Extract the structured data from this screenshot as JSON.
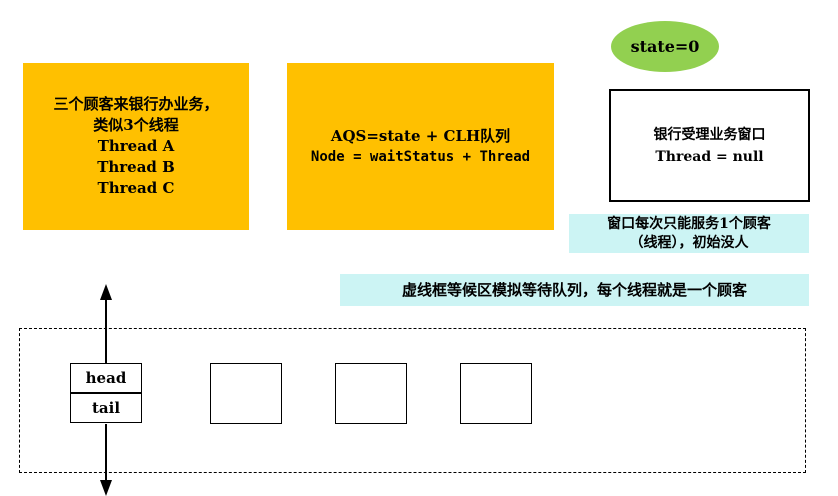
{
  "customers_box": {
    "lines": [
      "三个顾客来银行办业务，",
      "类似3个线程",
      "Thread A",
      "Thread B",
      "Thread C"
    ]
  },
  "aqs_box": {
    "line1": "AQS=state + CLH队列",
    "line2": "Node = waitStatus + Thread"
  },
  "state_oval": "state=0",
  "window_box": {
    "line1": "银行受理业务窗口",
    "line2": "Thread = null"
  },
  "window_note": {
    "line1": "窗口每次只能服务1个顾客",
    "line2": "（线程），初始没人"
  },
  "queue_note": "虚线框等候区模拟等待队列，每个线程就是一个顾客",
  "head_node": {
    "head": "head",
    "tail": "tail"
  },
  "colors": {
    "yellow": "#FFC000",
    "green": "#92D050",
    "cyan": "#CCF4F4"
  }
}
